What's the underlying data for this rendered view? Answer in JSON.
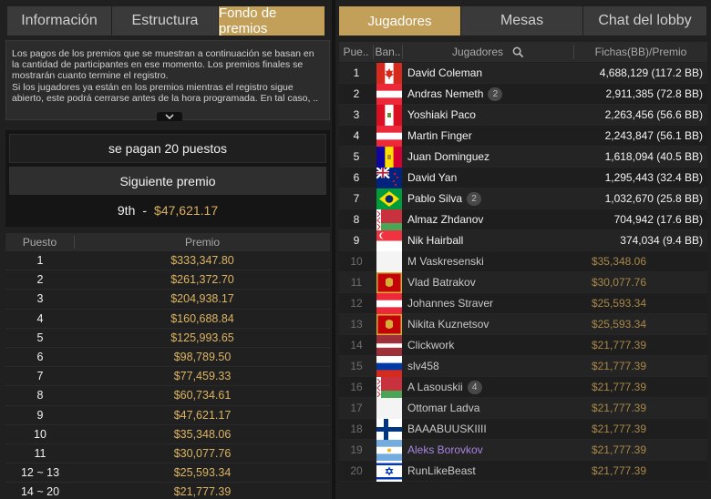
{
  "left": {
    "tabs": [
      {
        "label": "Información",
        "active": false
      },
      {
        "label": "Estructura",
        "active": false
      },
      {
        "label": "Fondo de premios",
        "active": true
      }
    ],
    "info_text": "Los pagos de los premios que se muestran a continuación se basan en la cantidad de participantes en ese momento. Los premios finales se mostrarán cuanto termine el registro.\nSi los jugadores ya están en los premios mientras el registro sigue abierto, este podrá cerrarse antes de la hora programada. En tal caso, ..",
    "paid_places": "se pagan 20 puestos",
    "next_prize_label": "Siguiente premio",
    "next_prize_position": "9th",
    "next_prize_separator": "-",
    "next_prize_amount": "$47,621.17",
    "table_headers": {
      "position": "Puesto",
      "prize": "Premio"
    },
    "prizes": [
      {
        "position": "1",
        "amount": "$333,347.80"
      },
      {
        "position": "2",
        "amount": "$261,372.70"
      },
      {
        "position": "3",
        "amount": "$204,938.17"
      },
      {
        "position": "4",
        "amount": "$160,688.84"
      },
      {
        "position": "5",
        "amount": "$125,993.65"
      },
      {
        "position": "6",
        "amount": "$98,789.50"
      },
      {
        "position": "7",
        "amount": "$77,459.33"
      },
      {
        "position": "8",
        "amount": "$60,734.61"
      },
      {
        "position": "9",
        "amount": "$47,621.17"
      },
      {
        "position": "10",
        "amount": "$35,348.06"
      },
      {
        "position": "11",
        "amount": "$30,077.76"
      },
      {
        "position": "12 ~ 13",
        "amount": "$25,593.34"
      },
      {
        "position": "14 ~ 20",
        "amount": "$21,777.39"
      }
    ]
  },
  "right": {
    "tabs": [
      {
        "label": "Jugadores",
        "active": true
      },
      {
        "label": "Mesas",
        "active": false
      },
      {
        "label": "Chat del lobby",
        "active": false
      }
    ],
    "headers": {
      "rank": "Pue..",
      "flag": "Ban..",
      "name": "Jugadores",
      "chips": "Fichas(BB)/Premio"
    },
    "search_icon": "search-icon",
    "players": [
      {
        "rank": "1",
        "flag": "canada",
        "name": "David Coleman",
        "badge": "",
        "value": "4,688,129 (117.2 BB)",
        "status": "active"
      },
      {
        "rank": "2",
        "flag": "austria",
        "name": "Andras Nemeth",
        "badge": "2",
        "value": "2,911,385 (72.8 BB)",
        "status": "active"
      },
      {
        "rank": "3",
        "flag": "peru",
        "name": "Yoshiaki Paco",
        "badge": "",
        "value": "2,263,456 (56.6 BB)",
        "status": "active"
      },
      {
        "rank": "4",
        "flag": "austria",
        "name": "Martin Finger",
        "badge": "",
        "value": "2,243,847 (56.1 BB)",
        "status": "active"
      },
      {
        "rank": "5",
        "flag": "andorra",
        "name": "Juan Dominguez",
        "badge": "",
        "value": "1,618,094 (40.5 BB)",
        "status": "active"
      },
      {
        "rank": "6",
        "flag": "new-zealand",
        "name": "David Yan",
        "badge": "",
        "value": "1,295,443 (32.4 BB)",
        "status": "active"
      },
      {
        "rank": "7",
        "flag": "brazil",
        "name": "Pablo Silva",
        "badge": "2",
        "value": "1,032,670 (25.8 BB)",
        "status": "active"
      },
      {
        "rank": "8",
        "flag": "belarus",
        "name": "Almaz Zhdanov",
        "badge": "",
        "value": "704,942 (17.6 BB)",
        "status": "active"
      },
      {
        "rank": "9",
        "flag": "singapore",
        "name": "Nik Hairball",
        "badge": "",
        "value": "374,034 (9.4 BB)",
        "status": "active"
      },
      {
        "rank": "10",
        "flag": "white",
        "name": "M Vaskresenski",
        "badge": "",
        "value": "$35,348.06",
        "status": "out"
      },
      {
        "rank": "11",
        "flag": "montenegro",
        "name": "Vlad Batrakov",
        "badge": "",
        "value": "$30,077.76",
        "status": "out"
      },
      {
        "rank": "12",
        "flag": "austria",
        "name": "Johannes Straver",
        "badge": "",
        "value": "$25,593.34",
        "status": "out"
      },
      {
        "rank": "13",
        "flag": "montenegro",
        "name": "Nikita Kuznetsov",
        "badge": "",
        "value": "$25,593.34",
        "status": "out"
      },
      {
        "rank": "14",
        "flag": "latvia",
        "name": "Clickwork",
        "badge": "",
        "value": "$21,777.39",
        "status": "out"
      },
      {
        "rank": "15",
        "flag": "russia",
        "name": "slv458",
        "badge": "",
        "value": "$21,777.39",
        "status": "out"
      },
      {
        "rank": "16",
        "flag": "belarus",
        "name": "A Lasouskii",
        "badge": "4",
        "value": "$21,777.39",
        "status": "out"
      },
      {
        "rank": "17",
        "flag": "white",
        "name": "Ottomar Ladva",
        "badge": "",
        "value": "$21,777.39",
        "status": "out"
      },
      {
        "rank": "18",
        "flag": "finland",
        "name": "BAAABUUSKIIII",
        "badge": "",
        "value": "$21,777.39",
        "status": "out"
      },
      {
        "rank": "19",
        "flag": "argentina",
        "name": "Aleks Borovkov",
        "badge": "",
        "value": "$21,777.39",
        "status": "me"
      },
      {
        "rank": "20",
        "flag": "israel",
        "name": "RunLikeBeast",
        "badge": "",
        "value": "$21,777.39",
        "status": "out"
      }
    ]
  },
  "colors": {
    "accent_gold": "#c2a05a",
    "prize_text": "#dcb463",
    "eliminated_prize": "#a88848",
    "highlight_player": "#a585e0",
    "panel_bg": "#202020"
  }
}
